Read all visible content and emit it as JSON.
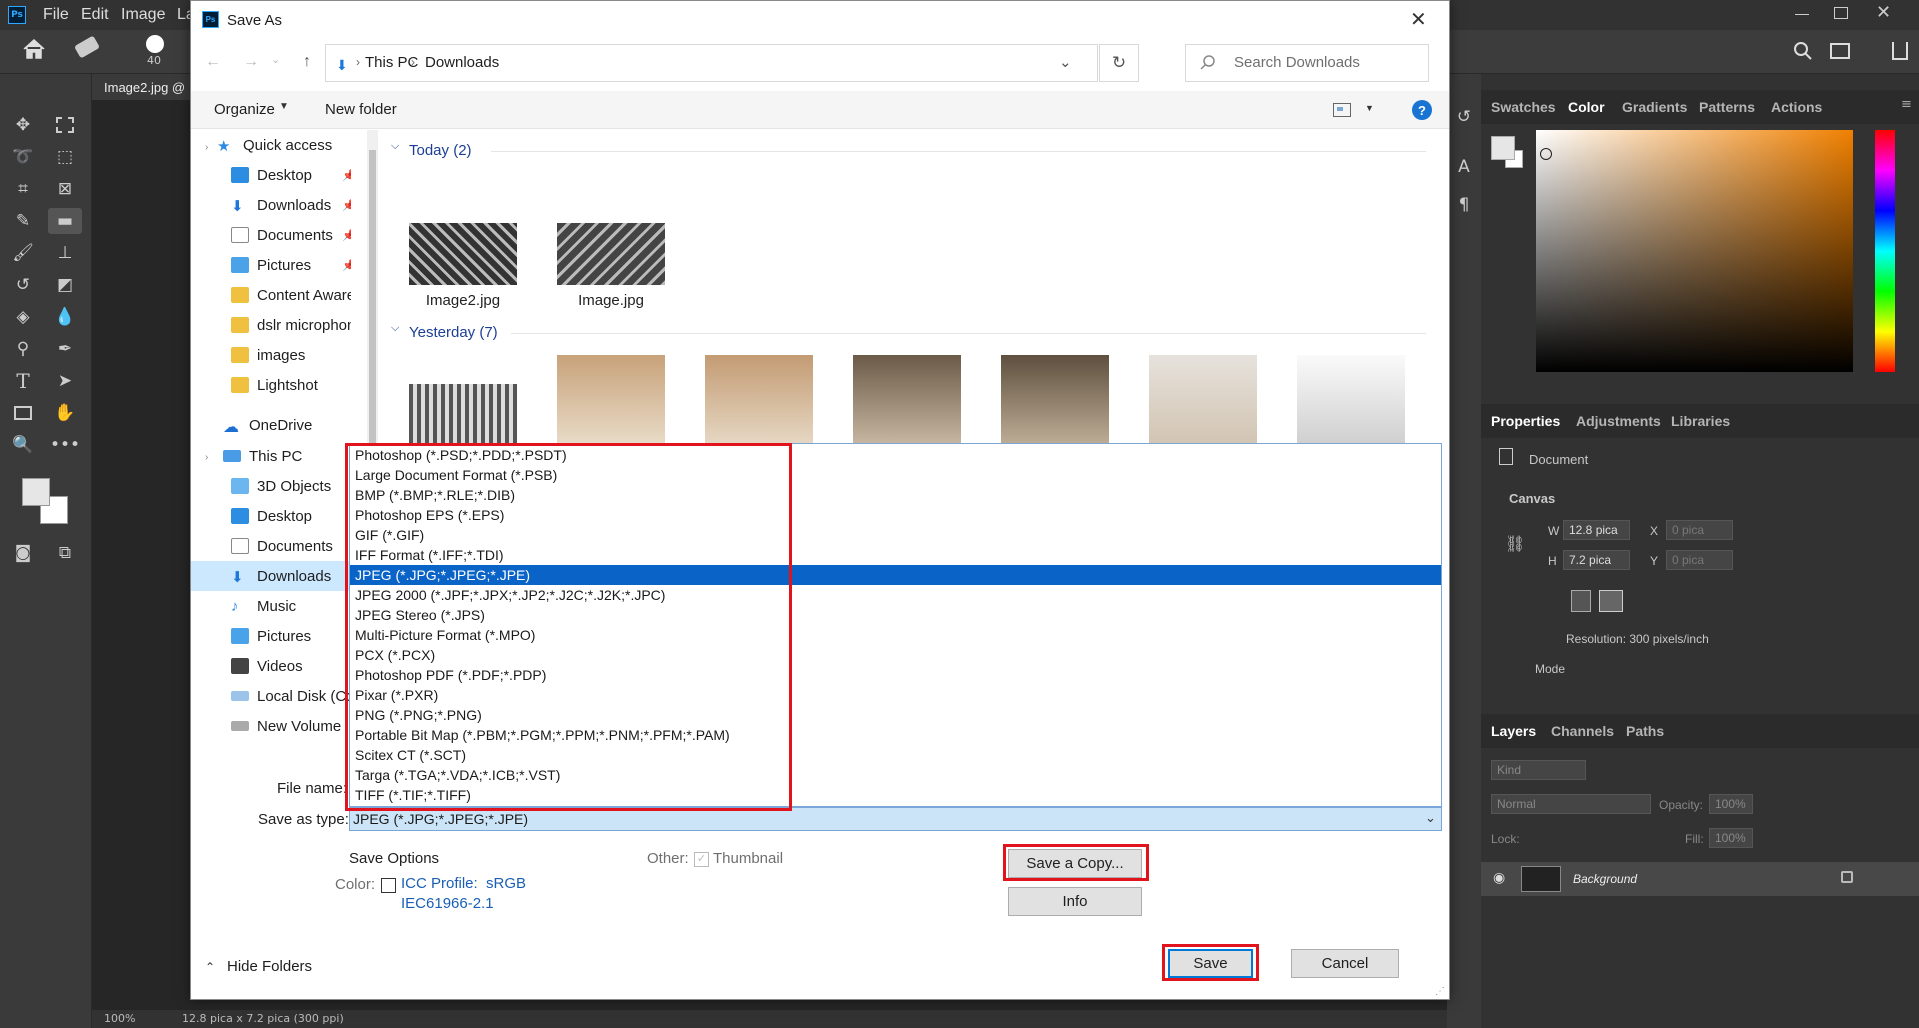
{
  "ps": {
    "menu": [
      "File",
      "Edit",
      "Image",
      "La"
    ],
    "brush_size": "40",
    "doc_tab": "Image2.jpg @",
    "status": {
      "zoom": "100%",
      "doc_info": "12.8 pica x 7.2 pica (300 ppi)"
    },
    "color_panel": {
      "tabs": [
        "Swatches",
        "Color",
        "Gradients",
        "Patterns",
        "Actions"
      ],
      "active": "Color"
    },
    "properties_panel": {
      "tabs": [
        "Properties",
        "Adjustments",
        "Libraries"
      ],
      "doc_label": "Document",
      "section": "Canvas",
      "w_label": "W",
      "w_value": "12.8 pica",
      "h_label": "H",
      "h_value": "7.2 pica",
      "x_label": "X",
      "x_value": "0 pica",
      "y_label": "Y",
      "y_value": "0 pica",
      "resolution": "Resolution: 300 pixels/inch",
      "mode_label": "Mode"
    },
    "layers_panel": {
      "tabs": [
        "Layers",
        "Channels",
        "Paths"
      ],
      "kind": "Kind",
      "blend_mode": "Normal",
      "opacity_label": "Opacity:",
      "opacity_value": "100%",
      "lock_label": "Lock:",
      "fill_label": "Fill:",
      "fill_value": "100%",
      "layer_name": "Background"
    },
    "colors": {
      "fg": "#e6e6e6",
      "bg": "#ffffff",
      "accent": "#0a64c8"
    }
  },
  "dialog": {
    "title": "Save As",
    "breadcrumb": [
      "This PC",
      "Downloads"
    ],
    "search_placeholder": "Search Downloads",
    "organize": "Organize",
    "new_folder": "New folder",
    "nav": {
      "quick_access": "Quick access",
      "quick_items": [
        "Desktop",
        "Downloads",
        "Documents",
        "Pictures",
        "Content Aware F",
        "dslr microphone",
        "images",
        "Lightshot"
      ],
      "onedrive": "OneDrive",
      "this_pc": "This PC",
      "pc_items": [
        "3D Objects",
        "Desktop",
        "Documents",
        "Downloads",
        "Music",
        "Pictures",
        "Videos",
        "Local Disk (C:",
        "New Volume"
      ]
    },
    "groups": {
      "today": "Today (2)",
      "yesterday": "Yesterday (7)"
    },
    "today_files": [
      "Image2.jpg",
      "Image.jpg"
    ],
    "file_name_label": "File name:",
    "save_as_type_label": "Save as type:",
    "save_as_type_value": "JPEG (*.JPG;*.JPEG;*.JPE)",
    "type_options": [
      "Photoshop (*.PSD;*.PDD;*.PSDT)",
      "Large Document Format (*.PSB)",
      "BMP (*.BMP;*.RLE;*.DIB)",
      "Photoshop EPS (*.EPS)",
      "GIF (*.GIF)",
      "IFF Format (*.IFF;*.TDI)",
      "JPEG (*.JPG;*.JPEG;*.JPE)",
      "JPEG 2000 (*.JPF;*.JPX;*.JP2;*.J2C;*.J2K;*.JPC)",
      "JPEG Stereo (*.JPS)",
      "Multi-Picture Format (*.MPO)",
      "PCX (*.PCX)",
      "Photoshop PDF (*.PDF;*.PDP)",
      "Pixar (*.PXR)",
      "PNG (*.PNG;*.PNG)",
      "Portable Bit Map (*.PBM;*.PGM;*.PPM;*.PNM;*.PFM;*.PAM)",
      "Scitex CT (*.SCT)",
      "Targa (*.TGA;*.VDA;*.ICB;*.VST)",
      "TIFF (*.TIF;*.TIFF)"
    ],
    "selected_type_index": 6,
    "save_options": "Save Options",
    "color_label": "Color:",
    "icc_profile": "ICC Profile:  sRGB",
    "icc_profile_line2": "IEC61966-2.1",
    "other_label": "Other:",
    "thumbnail": "Thumbnail",
    "save_copy": "Save a Copy...",
    "info": "Info",
    "save": "Save",
    "cancel": "Cancel",
    "hide_folders": "Hide Folders"
  }
}
